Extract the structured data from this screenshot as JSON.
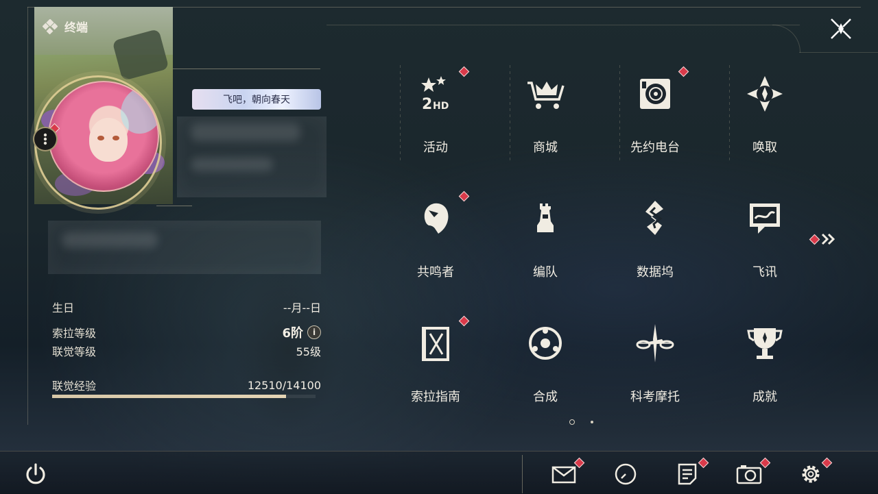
{
  "header": {
    "title": "终端"
  },
  "profile": {
    "signature": "飞吧，朝向春天"
  },
  "stats": {
    "birthday_label": "生日",
    "birthday_value": "--月--日",
    "sola_label": "索拉等级",
    "sola_value": "6阶",
    "union_label": "联觉等级",
    "union_value": "55级",
    "exp_label": "联觉经验",
    "exp_value": "12510/14100",
    "exp_progress": 0.887
  },
  "menu": {
    "items": [
      {
        "label": "活动",
        "icon": "event-icon",
        "badge": true
      },
      {
        "label": "商城",
        "icon": "shop-crown-cart-icon",
        "badge": true
      },
      {
        "label": "先约电台",
        "icon": "radio-record-icon",
        "badge": true
      },
      {
        "label": "唤取",
        "icon": "compass-star-icon",
        "badge": true
      },
      {
        "label": "共鸣者",
        "icon": "resonator-head-icon",
        "badge": true
      },
      {
        "label": "编队",
        "icon": "chess-team-icon",
        "badge": false
      },
      {
        "label": "数据坞",
        "icon": "data-dock-icon",
        "badge": true
      },
      {
        "label": "飞讯",
        "icon": "chat-message-icon",
        "badge": true
      },
      {
        "label": "索拉指南",
        "icon": "guide-book-icon",
        "badge": true
      },
      {
        "label": "合成",
        "icon": "synthesis-icon",
        "badge": false
      },
      {
        "label": "科考摩托",
        "icon": "motorcycle-icon",
        "badge": true
      },
      {
        "label": "成就",
        "icon": "trophy-icon",
        "badge": false
      }
    ]
  },
  "pager": {
    "pages": 2,
    "current": 1
  },
  "colors": {
    "badge": "#d93a4a",
    "accent": "#e0ce96",
    "text": "#f0ece2"
  }
}
